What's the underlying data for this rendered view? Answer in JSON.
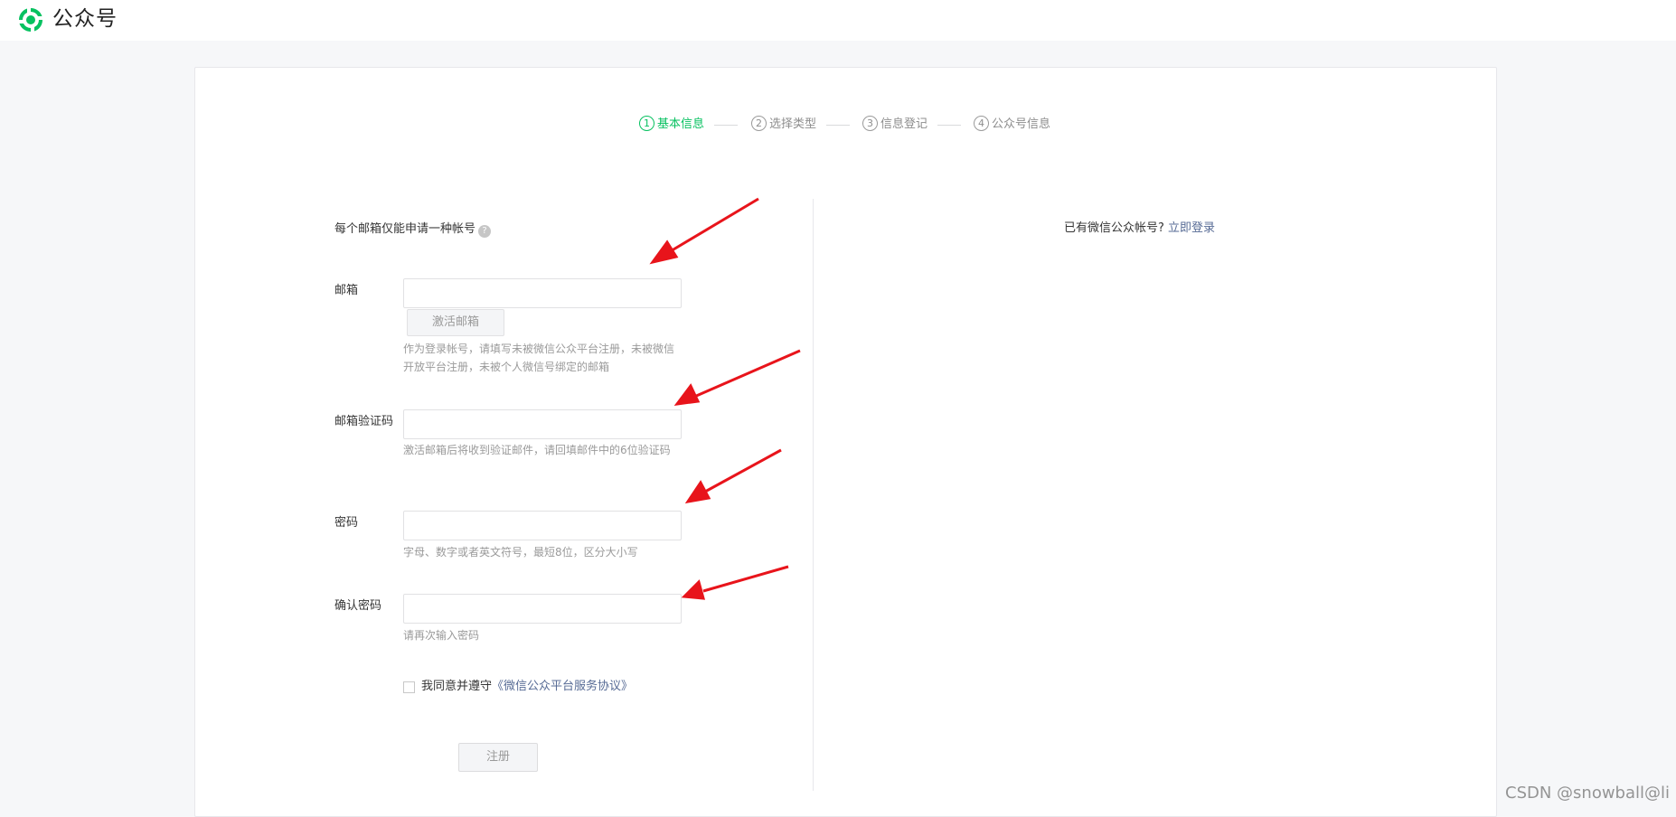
{
  "header": {
    "brand": "公众号"
  },
  "steps": [
    {
      "num": "1",
      "label": "基本信息",
      "active": true
    },
    {
      "num": "2",
      "label": "选择类型",
      "active": false
    },
    {
      "num": "3",
      "label": "信息登记",
      "active": false
    },
    {
      "num": "4",
      "label": "公众号信息",
      "active": false
    }
  ],
  "form": {
    "notice": "每个邮箱仅能申请一种帐号",
    "email": {
      "label": "邮箱",
      "value": "",
      "activate_button": "激活邮箱",
      "tip": "作为登录帐号，请填写未被微信公众平台注册，未被微信开放平台注册，未被个人微信号绑定的邮箱"
    },
    "code": {
      "label": "邮箱验证码",
      "value": "",
      "tip": "激活邮箱后将收到验证邮件，请回填邮件中的6位验证码"
    },
    "password": {
      "label": "密码",
      "value": "",
      "tip": "字母、数字或者英文符号，最短8位，区分大小写"
    },
    "confirm": {
      "label": "确认密码",
      "value": "",
      "tip": "请再次输入密码"
    },
    "agree": {
      "text": "我同意并遵守",
      "link": "《微信公众平台服务协议》",
      "checked": false
    },
    "register_button": "注册"
  },
  "side": {
    "hint": "已有微信公众帐号?",
    "login_link": "立即登录"
  },
  "colors": {
    "accent": "#07c160",
    "link": "#576b95",
    "arrow": "#e8141b"
  },
  "watermark": "CSDN @snowball@li"
}
